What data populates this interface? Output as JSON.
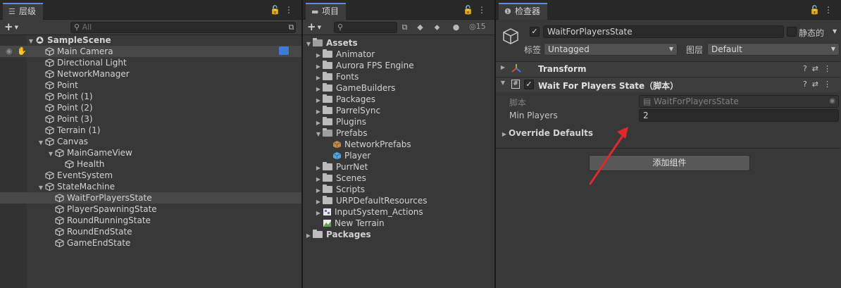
{
  "hierarchy": {
    "tab_label": "层级",
    "tab_icon": "list-icon",
    "search_placeholder": "All",
    "actions": [
      "lock-icon",
      "more-icon"
    ],
    "rows": [
      {
        "label": "SampleScene",
        "depth": 0,
        "fold": "open",
        "icon": "unity-scene-icon",
        "bold": true
      },
      {
        "label": "Main Camera",
        "depth": 1,
        "fold": "none",
        "icon": "cube-icon",
        "highlight": true
      },
      {
        "label": "Directional Light",
        "depth": 1,
        "fold": "none",
        "icon": "cube-icon"
      },
      {
        "label": "NetworkManager",
        "depth": 1,
        "fold": "none",
        "icon": "cube-icon"
      },
      {
        "label": "Point",
        "depth": 1,
        "fold": "none",
        "icon": "cube-icon"
      },
      {
        "label": "Point (1)",
        "depth": 1,
        "fold": "none",
        "icon": "cube-icon"
      },
      {
        "label": "Point (2)",
        "depth": 1,
        "fold": "none",
        "icon": "cube-icon"
      },
      {
        "label": "Point (3)",
        "depth": 1,
        "fold": "none",
        "icon": "cube-icon"
      },
      {
        "label": "Terrain (1)",
        "depth": 1,
        "fold": "none",
        "icon": "cube-icon"
      },
      {
        "label": "Canvas",
        "depth": 1,
        "fold": "open",
        "icon": "cube-icon"
      },
      {
        "label": "MainGameView",
        "depth": 2,
        "fold": "open",
        "icon": "cube-icon"
      },
      {
        "label": "Health",
        "depth": 3,
        "fold": "none",
        "icon": "cube-icon"
      },
      {
        "label": "EventSystem",
        "depth": 1,
        "fold": "none",
        "icon": "cube-icon"
      },
      {
        "label": "StateMachine",
        "depth": 1,
        "fold": "open",
        "icon": "cube-icon"
      },
      {
        "label": "WaitForPlayersState",
        "depth": 2,
        "fold": "none",
        "icon": "cube-icon",
        "selected": true
      },
      {
        "label": "PlayerSpawningState",
        "depth": 2,
        "fold": "none",
        "icon": "cube-icon"
      },
      {
        "label": "RoundRunningState",
        "depth": 2,
        "fold": "none",
        "icon": "cube-icon"
      },
      {
        "label": "RoundEndState",
        "depth": 2,
        "fold": "none",
        "icon": "cube-icon"
      },
      {
        "label": "GameEndState",
        "depth": 2,
        "fold": "none",
        "icon": "cube-icon"
      }
    ]
  },
  "project": {
    "tab_label": "项目",
    "tab_icon": "folder-icon",
    "hidden_count": "15",
    "toolbar_icons": [
      "search-by-type-icon",
      "label-icon",
      "warning-icon",
      "eye-hidden-icon"
    ],
    "rows": [
      {
        "label": "Assets",
        "depth": 0,
        "fold": "open",
        "icon": "folder-open-icon",
        "bold": true
      },
      {
        "label": "Animator",
        "depth": 1,
        "fold": "closed",
        "icon": "folder-icon"
      },
      {
        "label": "Aurora FPS Engine",
        "depth": 1,
        "fold": "closed",
        "icon": "folder-icon"
      },
      {
        "label": "Fonts",
        "depth": 1,
        "fold": "closed",
        "icon": "folder-icon"
      },
      {
        "label": "GameBuilders",
        "depth": 1,
        "fold": "closed",
        "icon": "folder-icon"
      },
      {
        "label": "Packages",
        "depth": 1,
        "fold": "closed",
        "icon": "folder-icon"
      },
      {
        "label": "ParrelSync",
        "depth": 1,
        "fold": "closed",
        "icon": "folder-icon"
      },
      {
        "label": "Plugins",
        "depth": 1,
        "fold": "closed",
        "icon": "folder-icon"
      },
      {
        "label": "Prefabs",
        "depth": 1,
        "fold": "open",
        "icon": "folder-open-icon"
      },
      {
        "label": "NetworkPrefabs",
        "depth": 2,
        "fold": "none",
        "icon": "prefab-brown-icon"
      },
      {
        "label": "Player",
        "depth": 2,
        "fold": "none",
        "icon": "prefab-blue-icon"
      },
      {
        "label": "PurrNet",
        "depth": 1,
        "fold": "closed",
        "icon": "folder-icon"
      },
      {
        "label": "Scenes",
        "depth": 1,
        "fold": "closed",
        "icon": "folder-icon"
      },
      {
        "label": "Scripts",
        "depth": 1,
        "fold": "closed",
        "icon": "folder-icon"
      },
      {
        "label": "URPDefaultResources",
        "depth": 1,
        "fold": "closed",
        "icon": "folder-icon"
      },
      {
        "label": "InputSystem_Actions",
        "depth": 1,
        "fold": "closed",
        "icon": "input-actions-icon"
      },
      {
        "label": "New Terrain",
        "depth": 1,
        "fold": "none",
        "icon": "terrain-icon"
      },
      {
        "label": "Packages",
        "depth": 0,
        "fold": "closed",
        "icon": "folder-icon",
        "bold": true
      }
    ]
  },
  "inspector": {
    "tab_label": "检查器",
    "tab_icon": "info-icon",
    "object_name": "WaitForPlayersState",
    "static_label": "静态的",
    "tag_label": "标签",
    "tag_value": "Untagged",
    "layer_label": "图层",
    "layer_value": "Default",
    "transform_title": "Transform",
    "script_component_title": "Wait For Players State（脚本）",
    "script_label": "脚本",
    "script_value": "WaitForPlayersState",
    "min_players_label": "Min Players",
    "min_players_value": "2",
    "override_label": "Override Defaults",
    "add_component_label": "添加组件"
  },
  "colors": {
    "panel_bg": "#383838",
    "selection": "#474747",
    "accent_tab": "#5a8be0",
    "annotation_arrow": "#e02a2a"
  }
}
